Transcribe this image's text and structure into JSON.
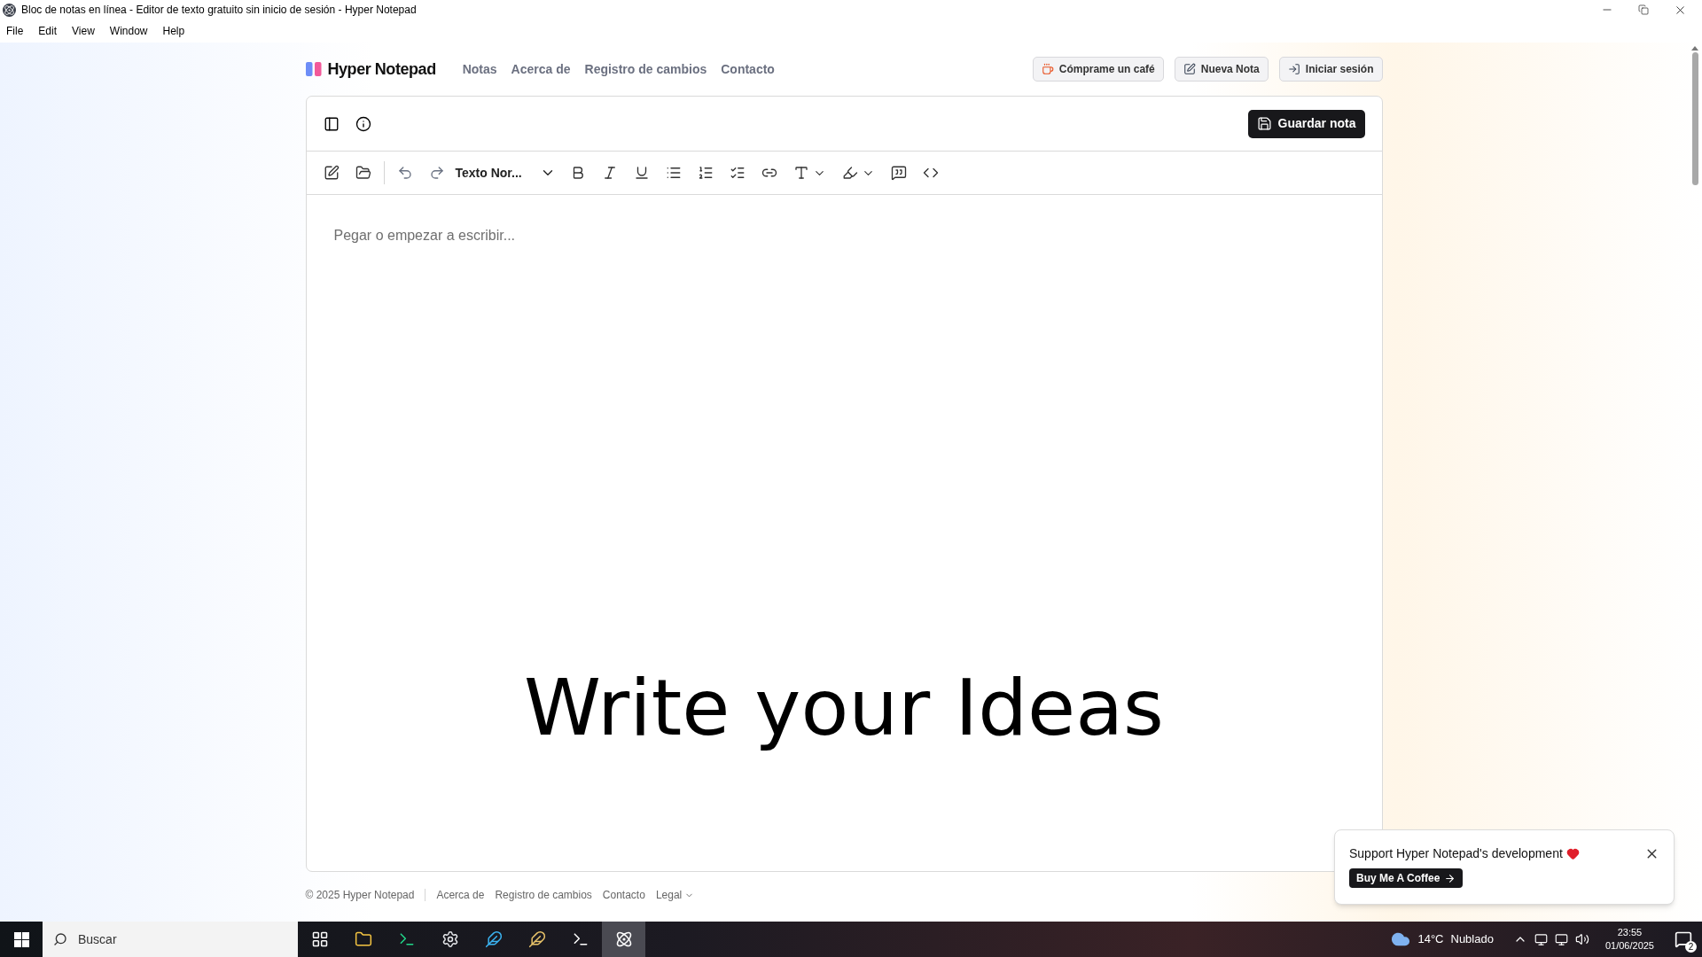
{
  "window": {
    "title": "Bloc de notas en línea - Editor de texto gratuito sin inicio de sesión - Hyper Notepad"
  },
  "menu": [
    "File",
    "Edit",
    "View",
    "Window",
    "Help"
  ],
  "header": {
    "brand": "Hyper Notepad",
    "nav": [
      "Notas",
      "Acerca de",
      "Registro de cambios",
      "Contacto"
    ],
    "buttons": [
      {
        "kind": "coffee",
        "label": "Cómprame un café"
      },
      {
        "kind": "new",
        "label": "Nueva Nota"
      },
      {
        "kind": "login",
        "label": "Iniciar sesión"
      }
    ]
  },
  "editor": {
    "save_button": "Guardar nota",
    "text_style": "Texto Nor...",
    "placeholder": "Pegar o empezar a escribir...",
    "hero": "Write your Ideas"
  },
  "footer": {
    "copyright": "© 2025 Hyper Notepad",
    "links": [
      "Acerca de",
      "Registro de cambios",
      "Contacto"
    ],
    "legal": "Legal"
  },
  "popup": {
    "message": "Support Hyper Notepad's development",
    "button": "Buy Me A Coffee"
  },
  "taskbar": {
    "search_placeholder": "Buscar",
    "temperature": "14°C",
    "weather": "Nublado",
    "time": "23:55",
    "date": "01/06/2025",
    "notifications": "2"
  }
}
